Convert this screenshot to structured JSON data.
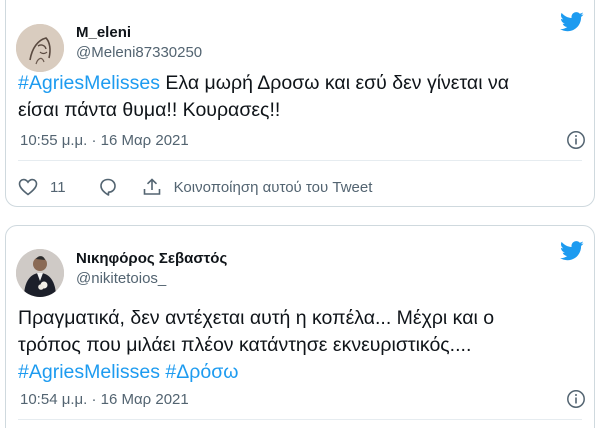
{
  "tweets": [
    {
      "author_name": "M_eleni",
      "author_handle": "@Meleni87330250",
      "text": {
        "hashtag": "#AgriesMelisses",
        "line1_rest": " Ελα μωρή Δροσω και εσύ δεν γίνεται να",
        "line2": "είσαι πάντα θυμα!! Κουρασες!!"
      },
      "timestamp": "10:55 μ.μ. · 16 Μαρ 2021",
      "like_count": "11",
      "share_label": "Κοινοποίηση αυτού του Tweet",
      "icons": {
        "like": "heart-icon",
        "reply": "reply-icon",
        "share": "share-icon",
        "info": "info-icon",
        "brand": "twitter-bird-icon"
      }
    },
    {
      "author_name": "Νικηφόρος Σεβαστός",
      "author_handle": "@nikitetoios_",
      "text": {
        "line1": "Πραγματικά, δεν αντέχεται αυτή η κοπέλα... Μέχρι και ο",
        "line2": "τρόπος που μιλάει πλέον κατάντησε εκνευριστικός....",
        "hashtag1": "#AgriesMelisses",
        "hashtag2": "#Δρόσω"
      },
      "timestamp": "10:54 μ.μ. · 16 Μαρ 2021",
      "icons": {
        "info": "info-icon",
        "brand": "twitter-bird-icon"
      }
    }
  ],
  "colors": {
    "brand_blue": "#1d9bf0",
    "text": "#0f1419",
    "muted": "#536471",
    "border": "#cfd9de"
  }
}
